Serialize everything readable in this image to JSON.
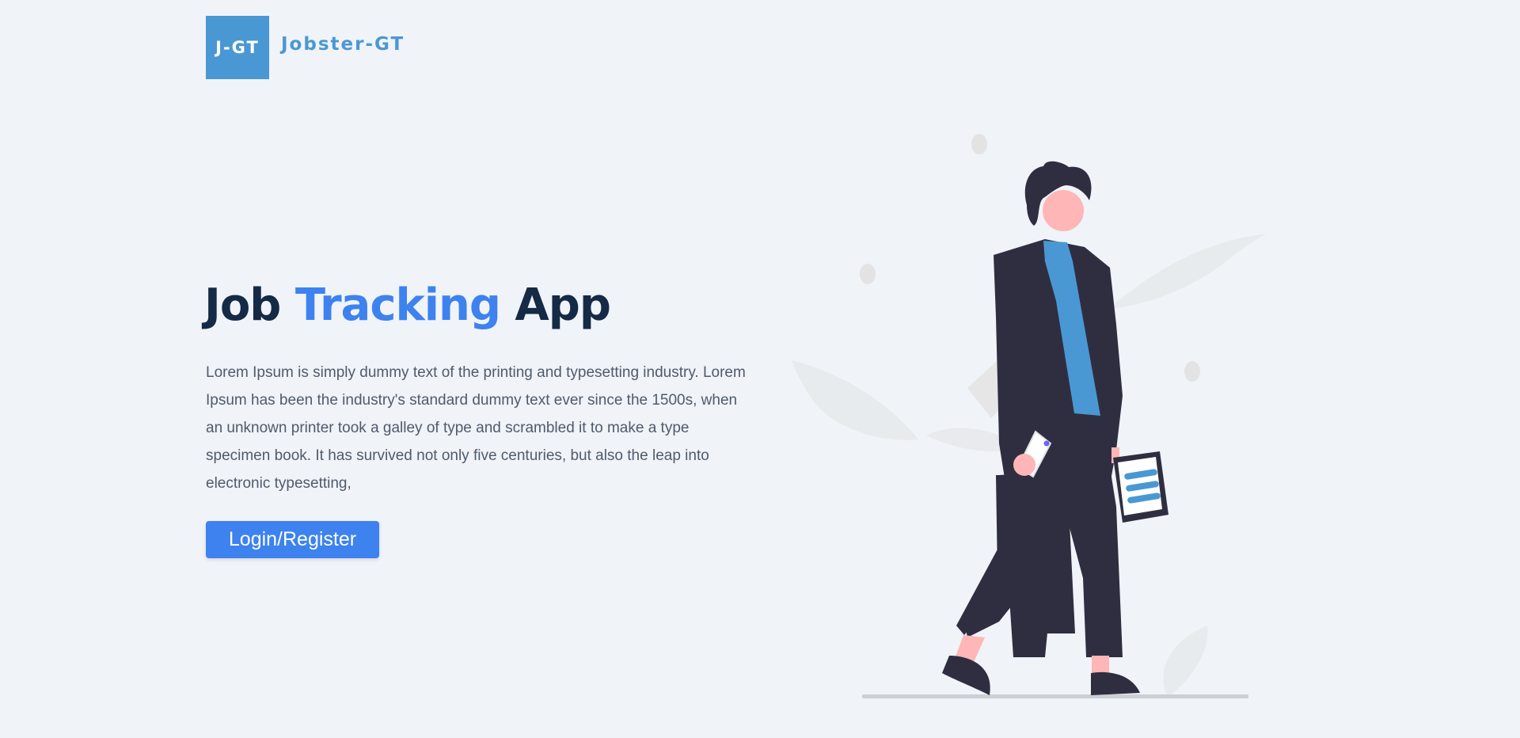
{
  "brand": {
    "logo_mark": "J-GT",
    "name": "Jobster-GT",
    "color": "#4a98d3"
  },
  "hero": {
    "title_part1": "Job ",
    "title_accent": "Tracking",
    "title_part2": " App",
    "description": "Lorem Ipsum is simply dummy text of the printing and typesetting industry. Lorem Ipsum has been the industry's standard dummy text ever since the 1500s, when an unknown printer took a galley of type and scrambled it to make a type specimen book. It has survived not only five centuries, but also the leap into electronic typesetting,",
    "cta_label": "Login/Register"
  },
  "colors": {
    "background": "#f0f3f8",
    "accent": "#3d82ee",
    "title": "#142a45",
    "body_text": "#4f5b6b",
    "illustration_suit": "#2f2e41",
    "illustration_tie": "#4a98d3",
    "illustration_skin": "#ffb6b6"
  },
  "illustration": {
    "icon": "walking-businessman-illustration"
  }
}
